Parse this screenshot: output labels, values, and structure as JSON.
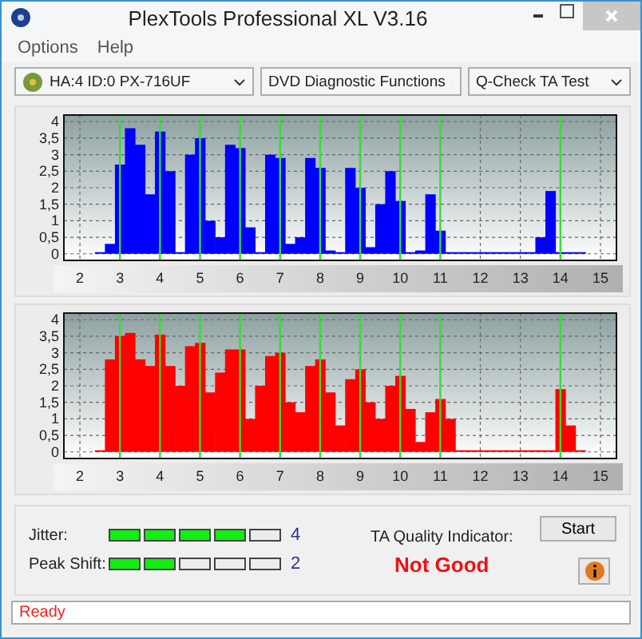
{
  "window": {
    "title": "PlexTools Professional XL V3.16"
  },
  "menu": [
    {
      "label": "Options"
    },
    {
      "label": "Help"
    }
  ],
  "selectors": [
    {
      "value": "HA:4 ID:0  PX-716UF",
      "kind": "device"
    },
    {
      "value": "DVD Diagnostic Functions",
      "kind": "plain"
    },
    {
      "value": "Q-Check TA Test",
      "kind": "plain"
    }
  ],
  "charts": [
    {
      "chart_data": {
        "type": "bar",
        "x": [
          2.5,
          2.75,
          3,
          3.25,
          3.5,
          3.75,
          4,
          4.25,
          4.5,
          4.75,
          5,
          5.25,
          5.5,
          5.75,
          6,
          6.25,
          6.5,
          6.75,
          7,
          7.25,
          7.5,
          7.75,
          8,
          8.25,
          8.5,
          8.75,
          9,
          9.25,
          9.5,
          9.75,
          10,
          10.25,
          10.5,
          10.75,
          11,
          11.25,
          11.5,
          11.75,
          12,
          12.25,
          12.5,
          12.75,
          13,
          13.25,
          13.5,
          13.75,
          14,
          14.25,
          14.5
        ],
        "grid": true,
        "series": [
          {
            "color": "#0000ff",
            "values": [
              0,
              0.3,
              2.7,
              3.8,
              3.3,
              1.8,
              3.7,
              2.5,
              0,
              3.0,
              3.5,
              1.0,
              0.5,
              3.3,
              3.2,
              0.8,
              0,
              3.0,
              2.9,
              0.3,
              0.5,
              2.9,
              2.6,
              0.1,
              0,
              2.6,
              2.0,
              0.2,
              1.5,
              2.5,
              1.6,
              0,
              0.1,
              1.8,
              0.7,
              0,
              0,
              0,
              0,
              0,
              0,
              0,
              0,
              0,
              0.5,
              1.9,
              0,
              0,
              0
            ]
          }
        ],
        "xlim": [
          1.6,
          15.4
        ],
        "ylim": [
          -0.2,
          4.2
        ],
        "xticks": [
          2,
          3,
          4,
          5,
          6,
          7,
          8,
          9,
          10,
          11,
          12,
          13,
          14,
          15
        ],
        "yticks": [
          {
            "value": 0,
            "label": "0"
          },
          {
            "value": 0.5,
            "label": "0,5"
          },
          {
            "value": 1,
            "label": "1"
          },
          {
            "value": 1.5,
            "label": "1,5"
          },
          {
            "value": 2,
            "label": "2"
          },
          {
            "value": 2.5,
            "label": "2,5"
          },
          {
            "value": 3,
            "label": "3"
          },
          {
            "value": 3.5,
            "label": "3,5"
          },
          {
            "value": 4,
            "label": "4"
          }
        ],
        "ref_lines": [
          {
            "axis": "x",
            "value": 3
          },
          {
            "axis": "x",
            "value": 4
          },
          {
            "axis": "x",
            "value": 5
          },
          {
            "axis": "x",
            "value": 6
          },
          {
            "axis": "x",
            "value": 7
          },
          {
            "axis": "x",
            "value": 8
          },
          {
            "axis": "x",
            "value": 9
          },
          {
            "axis": "x",
            "value": 10
          },
          {
            "axis": "x",
            "value": 11
          },
          {
            "axis": "x",
            "value": 14
          }
        ]
      }
    },
    {
      "chart_data": {
        "type": "bar",
        "x": [
          2.5,
          2.75,
          3,
          3.25,
          3.5,
          3.75,
          4,
          4.25,
          4.5,
          4.75,
          5,
          5.25,
          5.5,
          5.75,
          6,
          6.25,
          6.5,
          6.75,
          7,
          7.25,
          7.5,
          7.75,
          8,
          8.25,
          8.5,
          8.75,
          9,
          9.25,
          9.5,
          9.75,
          10,
          10.25,
          10.5,
          10.75,
          11,
          11.25,
          11.5,
          11.75,
          12,
          12.25,
          12.5,
          12.75,
          13,
          13.25,
          13.5,
          13.75,
          14,
          14.25,
          14.5
        ],
        "grid": true,
        "series": [
          {
            "color": "#ff0000",
            "values": [
              0,
              2.8,
              3.5,
              3.6,
              2.8,
              2.6,
              3.55,
              2.6,
              2.0,
              3.2,
              3.3,
              1.8,
              2.4,
              3.1,
              3.1,
              1.0,
              2.0,
              2.9,
              3.0,
              1.5,
              1.2,
              2.6,
              2.8,
              1.8,
              0.8,
              2.2,
              2.5,
              1.5,
              1.0,
              2.0,
              2.3,
              1.3,
              0.3,
              1.2,
              1.6,
              1.0,
              0,
              0,
              0,
              0,
              0,
              0,
              0,
              0,
              0,
              0,
              1.9,
              0.8,
              0
            ]
          }
        ],
        "xlim": [
          1.6,
          15.4
        ],
        "ylim": [
          -0.2,
          4.2
        ],
        "xticks": [
          2,
          3,
          4,
          5,
          6,
          7,
          8,
          9,
          10,
          11,
          12,
          13,
          14,
          15
        ],
        "yticks": [
          {
            "value": 0,
            "label": "0"
          },
          {
            "value": 0.5,
            "label": "0,5"
          },
          {
            "value": 1,
            "label": "1"
          },
          {
            "value": 1.5,
            "label": "1,5"
          },
          {
            "value": 2,
            "label": "2"
          },
          {
            "value": 2.5,
            "label": "2,5"
          },
          {
            "value": 3,
            "label": "3"
          },
          {
            "value": 3.5,
            "label": "3,5"
          },
          {
            "value": 4,
            "label": "4"
          }
        ],
        "ref_lines": [
          {
            "axis": "x",
            "value": 3
          },
          {
            "axis": "x",
            "value": 4
          },
          {
            "axis": "x",
            "value": 5
          },
          {
            "axis": "x",
            "value": 6
          },
          {
            "axis": "x",
            "value": 7
          },
          {
            "axis": "x",
            "value": 8
          },
          {
            "axis": "x",
            "value": 9
          },
          {
            "axis": "x",
            "value": 10
          },
          {
            "axis": "x",
            "value": 11
          },
          {
            "axis": "x",
            "value": 14
          }
        ]
      }
    }
  ],
  "meters": [
    {
      "label": "Jitter:",
      "level": 0.8,
      "reading": "4"
    },
    {
      "label": "Peak Shift:",
      "level": 0.4,
      "reading": "2"
    }
  ],
  "quality": {
    "label": "TA Quality Indicator:",
    "result": "Not Good"
  },
  "buttons": {
    "start": "Start"
  },
  "status_bar": {
    "text": "Ready"
  }
}
